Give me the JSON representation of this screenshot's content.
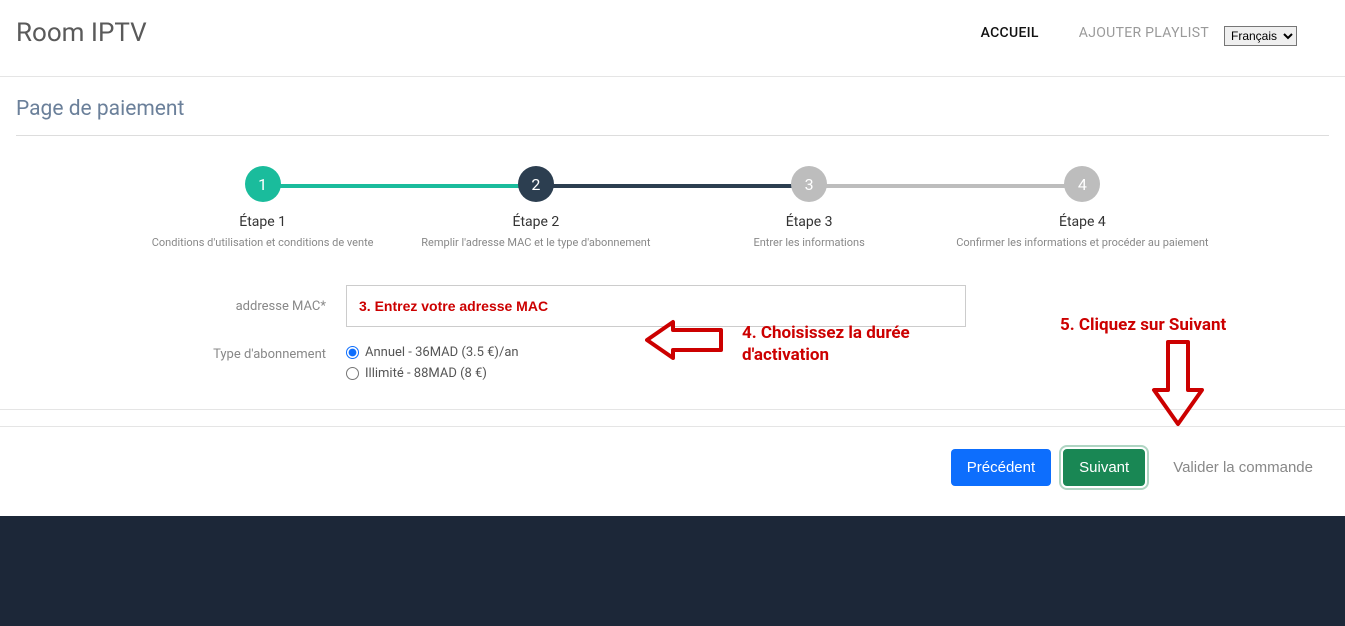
{
  "brand": "Room IPTV",
  "nav": {
    "home": "ACCUEIL",
    "addPlaylist": "AJOUTER PLAYLIST"
  },
  "lang": {
    "options": [
      "Français"
    ]
  },
  "pageTitle": "Page de paiement",
  "steps": [
    {
      "num": "1",
      "title": "Étape 1",
      "desc": "Conditions d'utilisation et conditions de vente"
    },
    {
      "num": "2",
      "title": "Étape 2",
      "desc": "Remplir l'adresse MAC et le type d'abonnement"
    },
    {
      "num": "3",
      "title": "Étape 3",
      "desc": "Entrer les informations"
    },
    {
      "num": "4",
      "title": "Étape 4",
      "desc": "Confirmer les informations et procéder au paiement"
    }
  ],
  "form": {
    "macLabel": "addresse MAC*",
    "macPlaceholder": "3. Entrez votre adresse MAC",
    "subLabel": "Type d'abonnement",
    "options": {
      "annual": "Annuel - 36MAD (3.5 €)/an",
      "unlimited": "Illimité - 88MAD (8 €)"
    }
  },
  "buttons": {
    "prev": "Précédent",
    "next": "Suivant",
    "validate": "Valider la commande"
  },
  "annotations": {
    "step4a": "4. Choisissez la durée",
    "step4b": "d'activation",
    "step5": "5. Cliquez sur Suivant"
  }
}
